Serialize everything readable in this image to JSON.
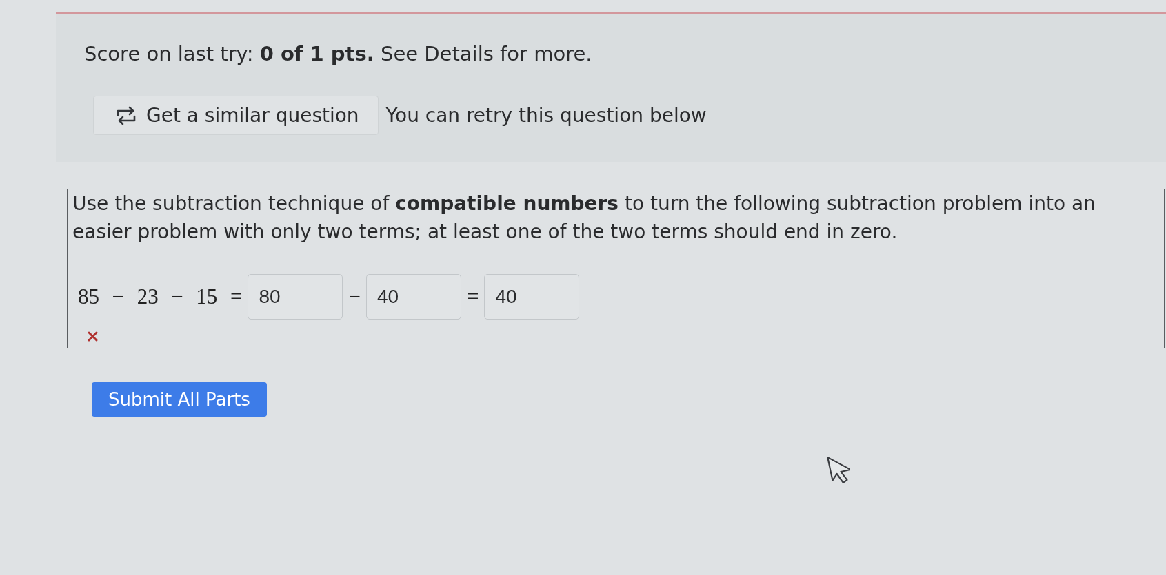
{
  "score": {
    "text": "Score on last try: **0 of 1 pts.** See Details for more."
  },
  "similar_button": {
    "label": "Get a similar question"
  },
  "retry_note": "You can retry this question below",
  "question": {
    "text": "Use the subtraction technique of **compatible numbers** to turn the following subtraction problem into an easier problem with only two terms; at least one of the two terms should end in zero.",
    "equation": [
      {
        "kind": "math",
        "text": "85 − 23 − 15 ="
      },
      {
        "kind": "input",
        "value": "80"
      },
      {
        "kind": "math",
        "text": "−"
      },
      {
        "kind": "input",
        "value": "40"
      },
      {
        "kind": "math",
        "text": "="
      },
      {
        "kind": "input",
        "value": "40"
      }
    ],
    "result": {
      "correct": false
    }
  },
  "submit_button": {
    "label": "Submit All Parts"
  }
}
